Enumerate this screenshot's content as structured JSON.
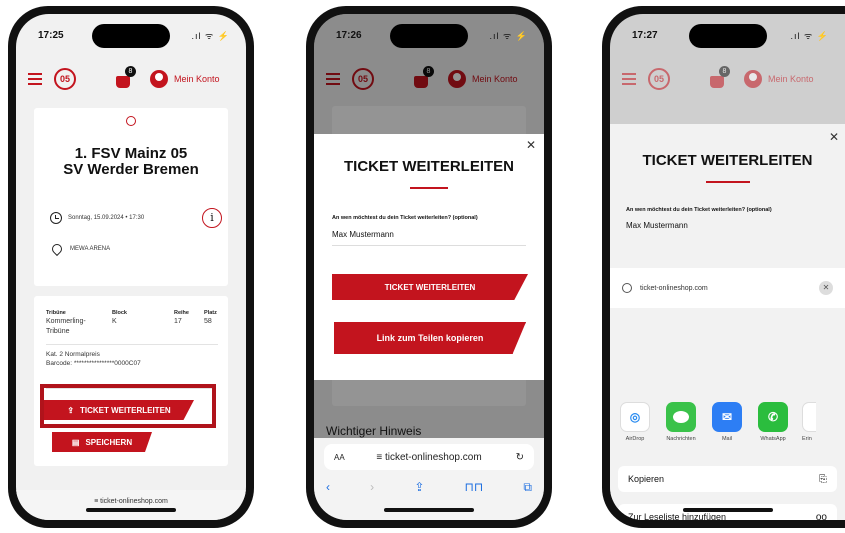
{
  "colors": {
    "accent": "#c3141e",
    "outline": "#b0131b",
    "airdrop": "#2b8cf0",
    "messages": "#3ac24a",
    "mail": "#2d7ef4",
    "whatsapp": "#2bbd3e"
  },
  "status": {
    "time1": "17:25",
    "time2": "17:26",
    "time3": "17:27",
    "signal": ".ıl ᯤ",
    "battery": "⚡"
  },
  "nav": {
    "logo": "05",
    "cart_count": "8",
    "account_label": "Mein Konto"
  },
  "phone1": {
    "match_line1": "1. FSV Mainz 05",
    "match_line2": "SV Werder Bremen",
    "datetime": "Sonntag, 15.09.2024 • 17:30",
    "venue": "MEWA ARENA",
    "info_glyph": "i",
    "headers": {
      "tribune": "Tribüne",
      "block": "Block",
      "row": "Reihe",
      "seat": "Platz"
    },
    "values": {
      "tribune_1": "Kommerling-",
      "tribune_2": "Tribüne",
      "block": "K",
      "row": "17",
      "seat": "58"
    },
    "category": "Kat. 2 Normalpreis",
    "barcode": "Barcode: ****************0000C07",
    "btn_forward": "TICKET WEITERLEITEN",
    "btn_save": "SPEICHERN",
    "bottom_url": "≡ ticket-onlineshop.com"
  },
  "phone2": {
    "modal_title": "TICKET WEITERLEITEN",
    "close": "✕",
    "field_label": "An wen möchtest du dein Ticket weiterleiten? (optional)",
    "field_value": "Max Mustermann",
    "btn_forward": "TICKET WEITERLEITEN",
    "btn_copy": "Link zum Teilen kopieren",
    "bg_heading": "Wichtiger Hinweis",
    "url_aa": "AA",
    "url": "≡ ticket-onlineshop.com",
    "reload": "↻",
    "nav_back": "‹",
    "nav_forward": "›",
    "nav_share": "⇪",
    "nav_book": "⊓⊓",
    "nav_tabs": "⧉"
  },
  "phone3": {
    "modal_title": "TICKET WEITERLEITEN",
    "close": "✕",
    "field_label": "An wen möchtest du dein Ticket weiterleiten? (optional)",
    "field_value": "Max Mustermann",
    "share_url": "ticket-onlineshop.com",
    "share_close": "✕",
    "apps": [
      {
        "label": "AirDrop",
        "glyph": "◎"
      },
      {
        "label": "Nachrichten",
        "glyph": "💬"
      },
      {
        "label": "Mail",
        "glyph": "✉"
      },
      {
        "label": "WhatsApp",
        "glyph": "✆"
      }
    ],
    "app_more": "Erin",
    "action_copy": "Kopieren",
    "action_copy_icon": "⎘",
    "action_reading": "Zur Leseliste hinzufügen",
    "action_reading_icon": "oo"
  }
}
